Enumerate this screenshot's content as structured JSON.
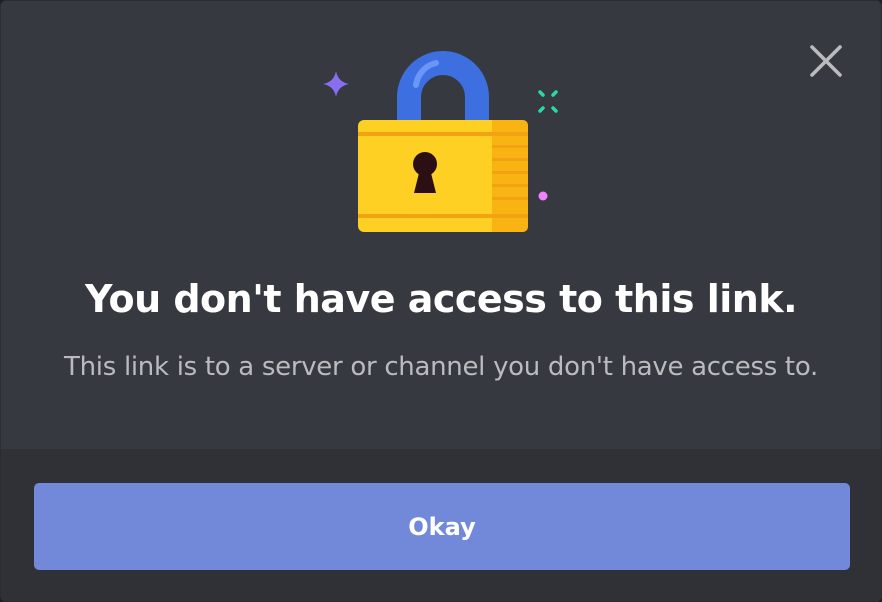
{
  "dialog": {
    "title": "You don't have access to this link.",
    "subtitle": "This link is to a server or channel you don't have access to.",
    "close_icon": "close-icon",
    "illustration_icon": "padlock-icon",
    "okay_label": "Okay"
  },
  "colors": {
    "modal_background": "#36393f",
    "footer_background": "#2f3136",
    "button_blurple": "#7289da",
    "title_text": "#ffffff",
    "subtitle_text": "#b9bbbe",
    "lock_body": "#fdd023",
    "lock_shackle": "#3e6fe0",
    "sparkle_purple": "#8a6ef0",
    "sparkle_green": "#2bd9a2",
    "sparkle_pink": "#f47fff"
  }
}
